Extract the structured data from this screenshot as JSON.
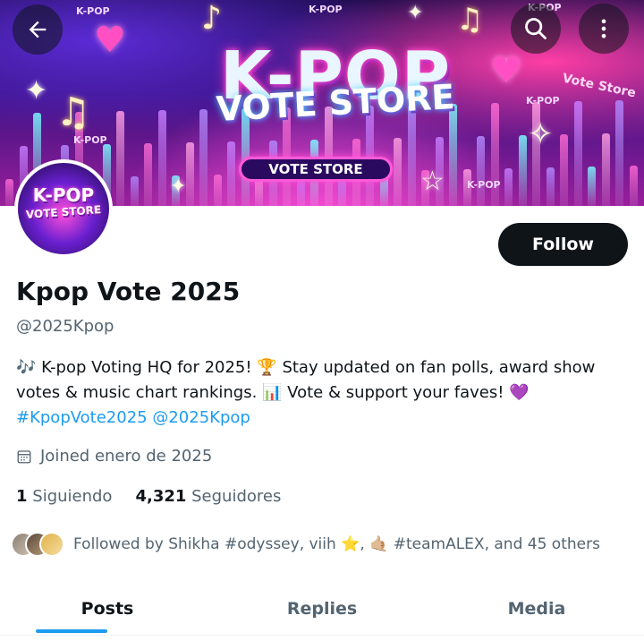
{
  "banner": {
    "title": "K-POP",
    "subtitle": "VOTE STORE",
    "pill": "VOTE STORE",
    "tag_labels": [
      "K-POP",
      "K-POP",
      "K-POP",
      "K-POP",
      "K-POP",
      "K-POP"
    ],
    "side_text": "Vote Store"
  },
  "top_bar": {
    "back_icon": "arrow-left-icon",
    "search_icon": "search-icon",
    "more_icon": "more-vertical-icon"
  },
  "avatar": {
    "line1": "K-POP",
    "line2": "VOTE STORE"
  },
  "profile": {
    "follow_label": "Follow",
    "name": "Kpop Vote 2025",
    "handle": "@2025Kpop",
    "bio_text": "🎶 K-pop Voting HQ for 2025! 🏆 Stay updated on fan polls, award show votes & music chart rankings. 📊 Vote & support your faves! 💜",
    "bio_hashtag": "#KpopVote2025",
    "bio_mention": "@2025Kpop",
    "joined": "Joined enero de 2025",
    "following_count": "1",
    "following_label": "Siguiendo",
    "followers_count": "4,321",
    "followers_label": "Seguidores",
    "followed_by": "Followed by Shikha #odyssey, viih ⭐, 🤙🏼 #teamALEX, and 45 others"
  },
  "tabs": [
    {
      "label": "Posts",
      "active": true
    },
    {
      "label": "Replies",
      "active": false
    },
    {
      "label": "Media",
      "active": false
    }
  ],
  "colors": {
    "accent": "#1d9bf0",
    "text": "#0f1419",
    "muted": "#536471",
    "follow_bg": "#0f1419"
  }
}
